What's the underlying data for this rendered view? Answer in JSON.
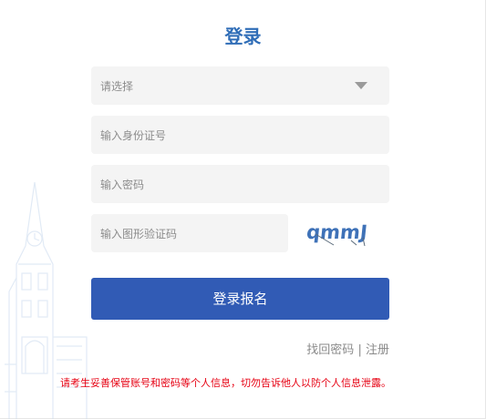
{
  "login": {
    "title": "登录",
    "select_placeholder": "请选择",
    "id_placeholder": "输入身份证号",
    "password_placeholder": "输入密码",
    "captcha_placeholder": "输入图形验证码",
    "captcha_text": "qmmJ",
    "submit_label": "登录报名",
    "forgot_label": "找回密码",
    "separator": "|",
    "register_label": "注册",
    "notice": "请考生妥善保管账号和密码等个人信息，切勿告诉他人以防个人信息泄露。"
  },
  "colors": {
    "title": "#2f6db7",
    "button": "#315bb5",
    "notice": "#e60012",
    "captcha": "#3f72b8"
  }
}
